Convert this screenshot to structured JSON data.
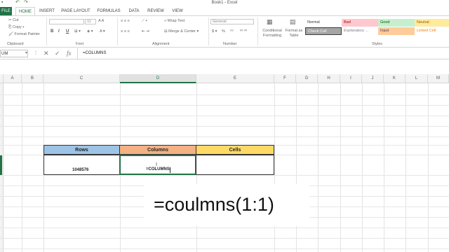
{
  "window": {
    "title": "Book1 - Excel"
  },
  "tabs": [
    {
      "label": "FILE"
    },
    {
      "label": "HOME"
    },
    {
      "label": "INSERT"
    },
    {
      "label": "PAGE LAYOUT"
    },
    {
      "label": "FORMULAS"
    },
    {
      "label": "DATA"
    },
    {
      "label": "REVIEW"
    },
    {
      "label": "VIEW"
    }
  ],
  "ribbon": {
    "clipboard": {
      "cut": "Cut",
      "copy": "Copy",
      "format_painter": "Format Painter",
      "label": "Clipboard"
    },
    "font": {
      "name": "",
      "size": "11",
      "label": "Font",
      "bold": "B",
      "italic": "I",
      "underline": "U"
    },
    "alignment": {
      "wrap": "Wrap Text",
      "merge": "Merge & Center",
      "label": "Alignment"
    },
    "number": {
      "format": "General",
      "label": "Number",
      "dollar": "$",
      "percent": "%"
    },
    "conditional": "Conditional Formatting",
    "format_as_table": "Format as Table",
    "styles": {
      "label": "Styles",
      "normal": "Normal",
      "bad": "Bad",
      "good": "Good",
      "neutral": "Neutral",
      "check_cell": "Check Cell",
      "explanatory": "Explanatory ...",
      "input": "Input",
      "linked_cell": "Linked Cell"
    }
  },
  "formula_bar": {
    "name_box": "UM",
    "formula": "=COLUMNS"
  },
  "columns": [
    "A",
    "B",
    "C",
    "D",
    "E",
    "F",
    "G",
    "H",
    "I",
    "J",
    "K",
    "L",
    "M"
  ],
  "table": {
    "headers": [
      "Rows",
      "Columns",
      "Cells"
    ],
    "values": [
      "1048576",
      "=COLUMNS",
      ""
    ]
  },
  "caption": "=coulmns(1:1)",
  "colors": {
    "rows_header": "#9DC3E6",
    "columns_header": "#F4B183",
    "cells_header": "#FFD966",
    "accent": "#217346"
  }
}
